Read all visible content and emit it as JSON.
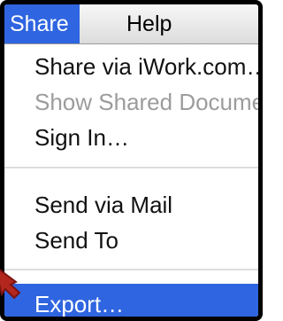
{
  "menubar": {
    "items": [
      {
        "label": "Share",
        "active": true
      },
      {
        "label": "Help",
        "active": false
      }
    ]
  },
  "menu": {
    "items": [
      {
        "label": "Share via iWork.com…",
        "enabled": true
      },
      {
        "label": "Show Shared Documents",
        "enabled": false
      },
      {
        "label": "Sign In…",
        "enabled": true
      },
      {
        "label": "Send via Mail",
        "enabled": true
      },
      {
        "label": "Send To",
        "enabled": true
      },
      {
        "label": "Export…",
        "enabled": true,
        "highlighted": true
      }
    ]
  },
  "colors": {
    "highlight": "#2f65e0",
    "disabled_text": "#9c9c9c",
    "annotation_arrow": "#b3261e"
  },
  "icons": {
    "cursor": "annotation-arrow-icon"
  }
}
